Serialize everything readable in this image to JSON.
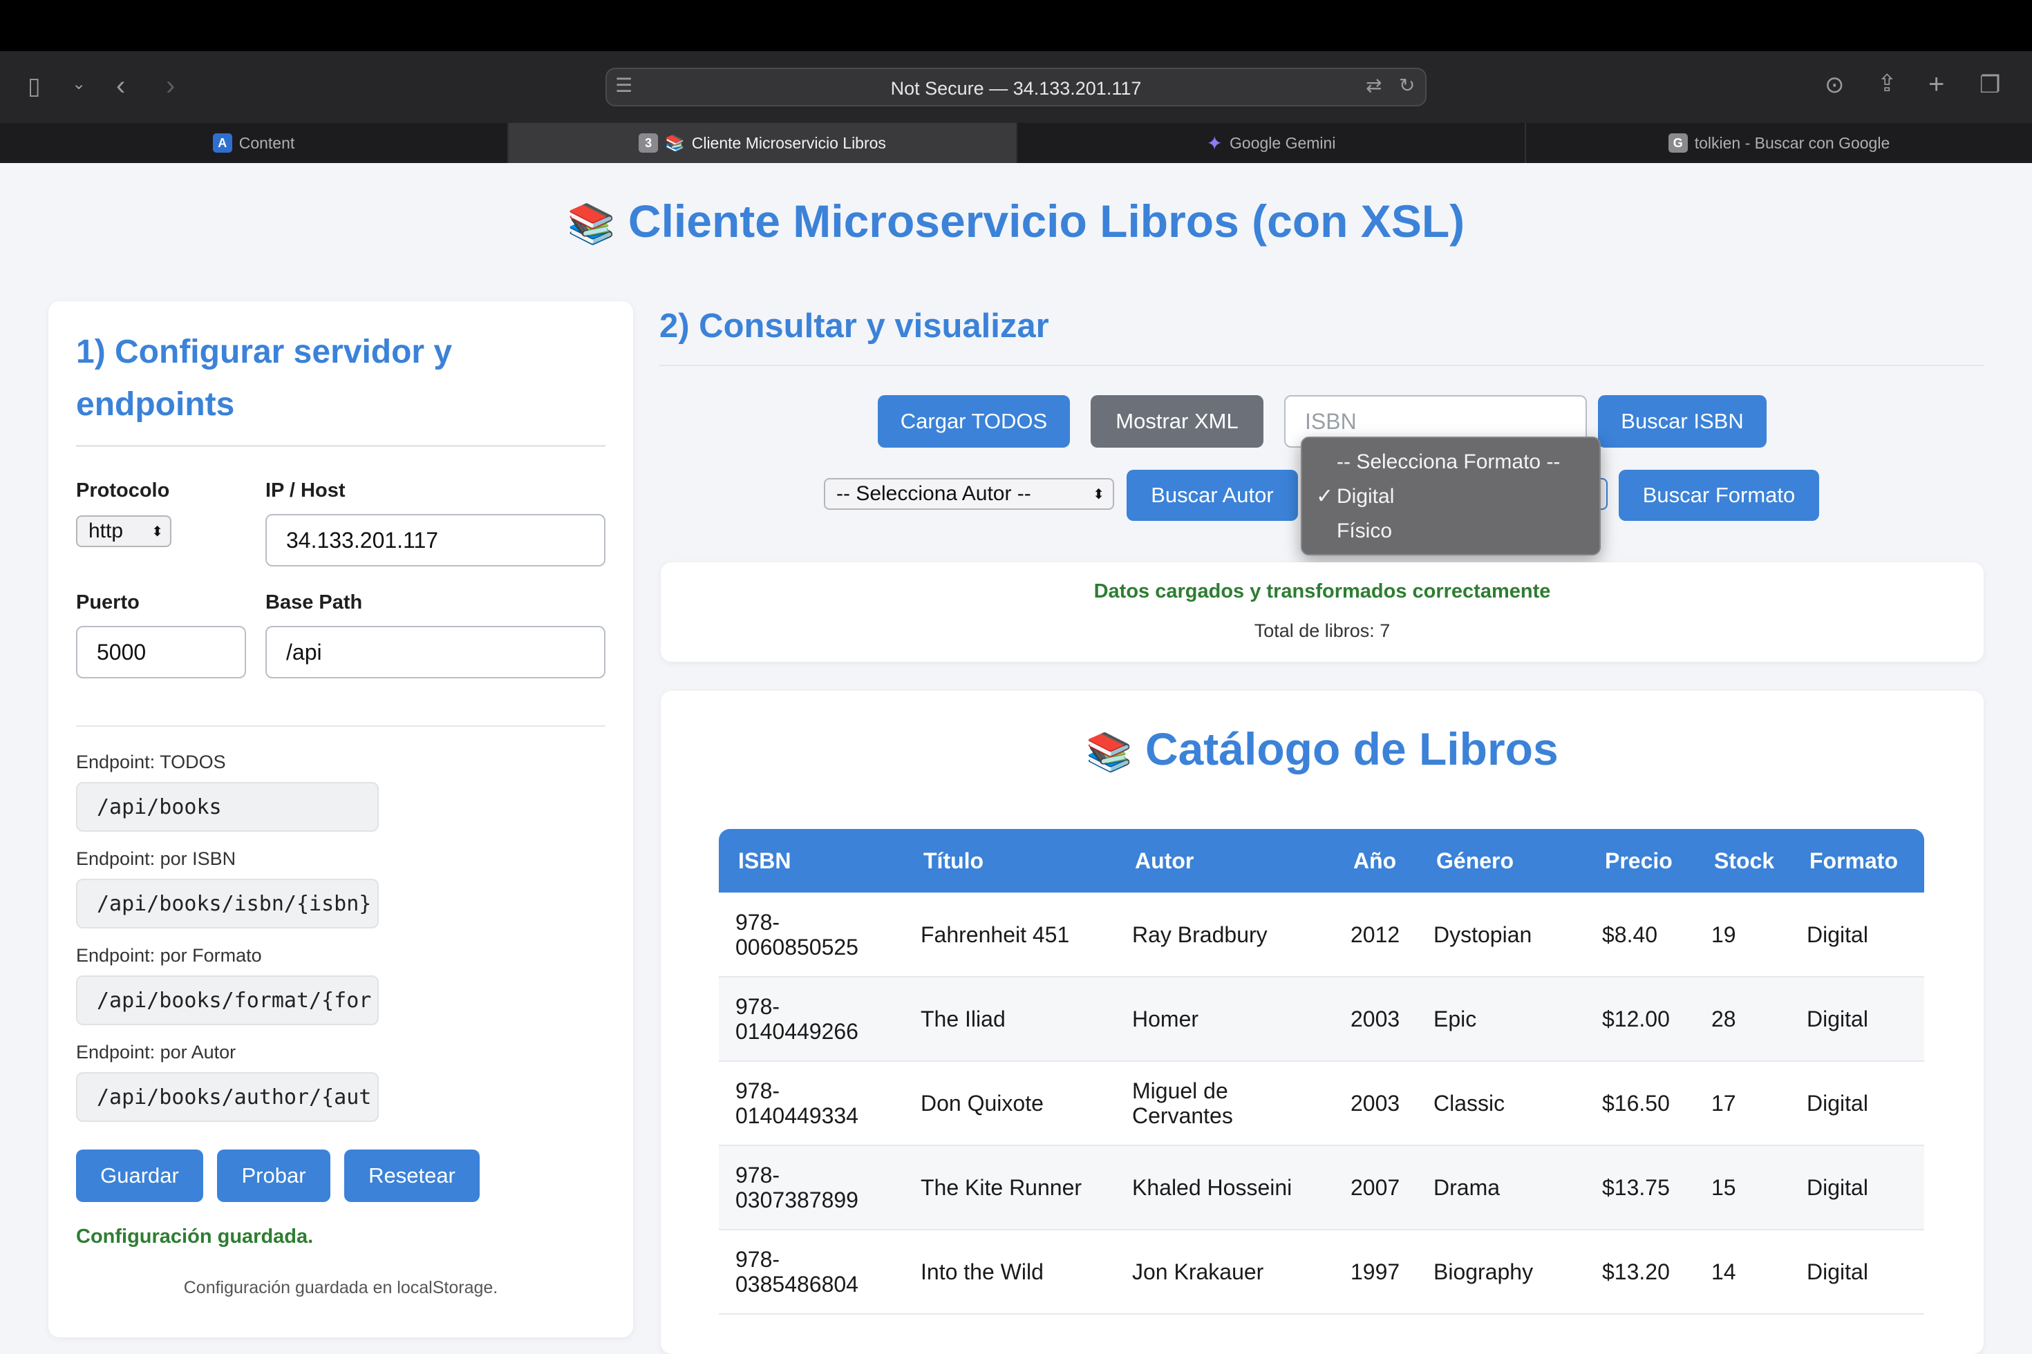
{
  "browser": {
    "url": "Not Secure — 34.133.201.117",
    "tabs": [
      {
        "label": "Content",
        "favicon": "A"
      },
      {
        "label": "Cliente Microservicio Libros",
        "badge": "3",
        "favicon": "📚"
      },
      {
        "label": "Google Gemini",
        "favicon": "✦"
      },
      {
        "label": "tolkien - Buscar con Google",
        "favicon": "G"
      }
    ]
  },
  "page": {
    "emoji": "📚",
    "title": "Cliente Microservicio Libros (con XSL)"
  },
  "config": {
    "heading_line1": "1) Configurar servidor y",
    "heading_line2": "endpoints",
    "protocol_label": "Protocolo",
    "protocol_value": "http",
    "host_label": "IP / Host",
    "host_value": "34.133.201.117",
    "port_label": "Puerto",
    "port_value": "5000",
    "basepath_label": "Base Path",
    "basepath_value": "/api",
    "endpoints": [
      {
        "label": "Endpoint: TODOS",
        "value": "/api/books"
      },
      {
        "label": "Endpoint: por ISBN",
        "value": "/api/books/isbn/{isbn}"
      },
      {
        "label": "Endpoint: por Formato",
        "value": "/api/books/format/{for"
      },
      {
        "label": "Endpoint: por Autor",
        "value": "/api/books/author/{aut"
      }
    ],
    "btn_save": "Guardar",
    "btn_test": "Probar",
    "btn_reset": "Resetear",
    "status": "Configuración guardada.",
    "note": "Configuración guardada en localStorage."
  },
  "query": {
    "heading": "2) Consultar y visualizar",
    "btn_load_all": "Cargar TODOS",
    "btn_show_xml": "Mostrar XML",
    "isbn_placeholder": "ISBN",
    "btn_search_isbn": "Buscar ISBN",
    "author_select": "-- Selecciona Autor --",
    "btn_search_author": "Buscar Autor",
    "btn_search_format": "Buscar Formato",
    "format_options": [
      "-- Selecciona Formato --",
      "Digital",
      "Físico"
    ],
    "format_selected": "Digital",
    "check": "✓",
    "status": "Datos cargados y transformados correctamente",
    "total": "Total de libros: 7"
  },
  "catalog": {
    "emoji": "📚",
    "title": "Catálogo de Libros",
    "columns": [
      "ISBN",
      "Título",
      "Autor",
      "Año",
      "Género",
      "Precio",
      "Stock",
      "Formato"
    ],
    "rows": [
      [
        "978-\n0060850525",
        "Fahrenheit 451",
        "Ray Bradbury",
        "2012",
        "Dystopian",
        "$8.40",
        "19",
        "Digital"
      ],
      [
        "978-\n0140449266",
        "The Iliad",
        "Homer",
        "2003",
        "Epic",
        "$12.00",
        "28",
        "Digital"
      ],
      [
        "978-\n0140449334",
        "Don Quixote",
        "Miguel de\nCervantes",
        "2003",
        "Classic",
        "$16.50",
        "17",
        "Digital"
      ],
      [
        "978-\n0307387899",
        "The Kite Runner",
        "Khaled Hosseini",
        "2007",
        "Drama",
        "$13.75",
        "15",
        "Digital"
      ],
      [
        "978-\n0385486804",
        "Into the Wild",
        "Jon Krakauer",
        "1997",
        "Biography",
        "$13.20",
        "14",
        "Digital"
      ]
    ]
  },
  "colors": {
    "accent": "#3b82d8",
    "success": "#2e7d32",
    "secondary": "#6c7079"
  }
}
